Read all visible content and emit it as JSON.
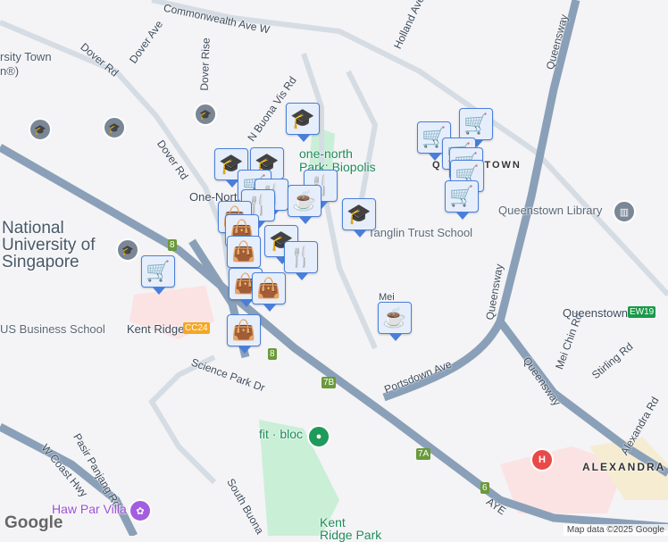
{
  "roads": {
    "commonwealth": "Commonwealth Ave W",
    "dover_rd_1": "Dover Rd",
    "dover_rd_2": "Dover Rd",
    "dover_ave": "Dover Ave",
    "dover_rise": "Dover Rise",
    "n_buona_vista": "N Buona Vis Rd",
    "holland": "Holland Ave",
    "queensway_1": "Queensway",
    "queensway_2": "Queensway",
    "queensway_3": "Queensway",
    "portsdown": "Portsdown Ave",
    "mei_chin": "Mei Chin Rd",
    "stirling": "Stirling Rd",
    "alexandra_rd": "Alexandra Rd",
    "science_park": "Science Park Dr",
    "w_coast": "W Coast Hwy",
    "pasir_panjang": "Pasir Panjang Rd",
    "south_buona": "South Buona",
    "aye": "AYE",
    "mei": "Mei"
  },
  "places": {
    "univ_town": "rsity Town",
    "univ_town_2": "n®)",
    "nus": "National University of Singapore",
    "nus_l1": "National",
    "nus_l2": "University",
    "nus_l3": "Singapore",
    "business_school": "US Business School",
    "kent_ridge": "Kent Ridge",
    "one_north": "One-North",
    "one_north_park": "one-north Park: Biopolis",
    "onp1": "one-north",
    "onp2": "Park: Biopolis",
    "queenstown_area": "QUEENSTOWN",
    "queenstown_library": "Queenstown Library",
    "tanglin": "Tanglin Trust School",
    "queenstown_station": "Queenstown",
    "alexandra": "ALEXANDRA",
    "fit_bloc": "fit · bloc",
    "haw_par": "Haw Par Villa",
    "kent_ridge_park": "Kent Ridge Park",
    "krp1": "Kent",
    "krp2": "Ridge Park"
  },
  "badges": {
    "cc24": "CC24",
    "ew19": "EW19",
    "exit_8a": "8",
    "exit_8b": "8",
    "exit_7b": "7B",
    "exit_7a": "7A",
    "exit_6": "6"
  },
  "colors": {
    "marker_bg": "#e6eefc",
    "marker_border": "#4a7fd9",
    "marker_icon": "#0e3b63",
    "highway": "#8aa0b8",
    "mrt_cc": "#f5a623",
    "mrt_ew": "#1a9a4a",
    "hospital": "#e84a4a"
  },
  "attribution": {
    "map_data": "Map data ©2025 Google",
    "logo": "Google"
  }
}
